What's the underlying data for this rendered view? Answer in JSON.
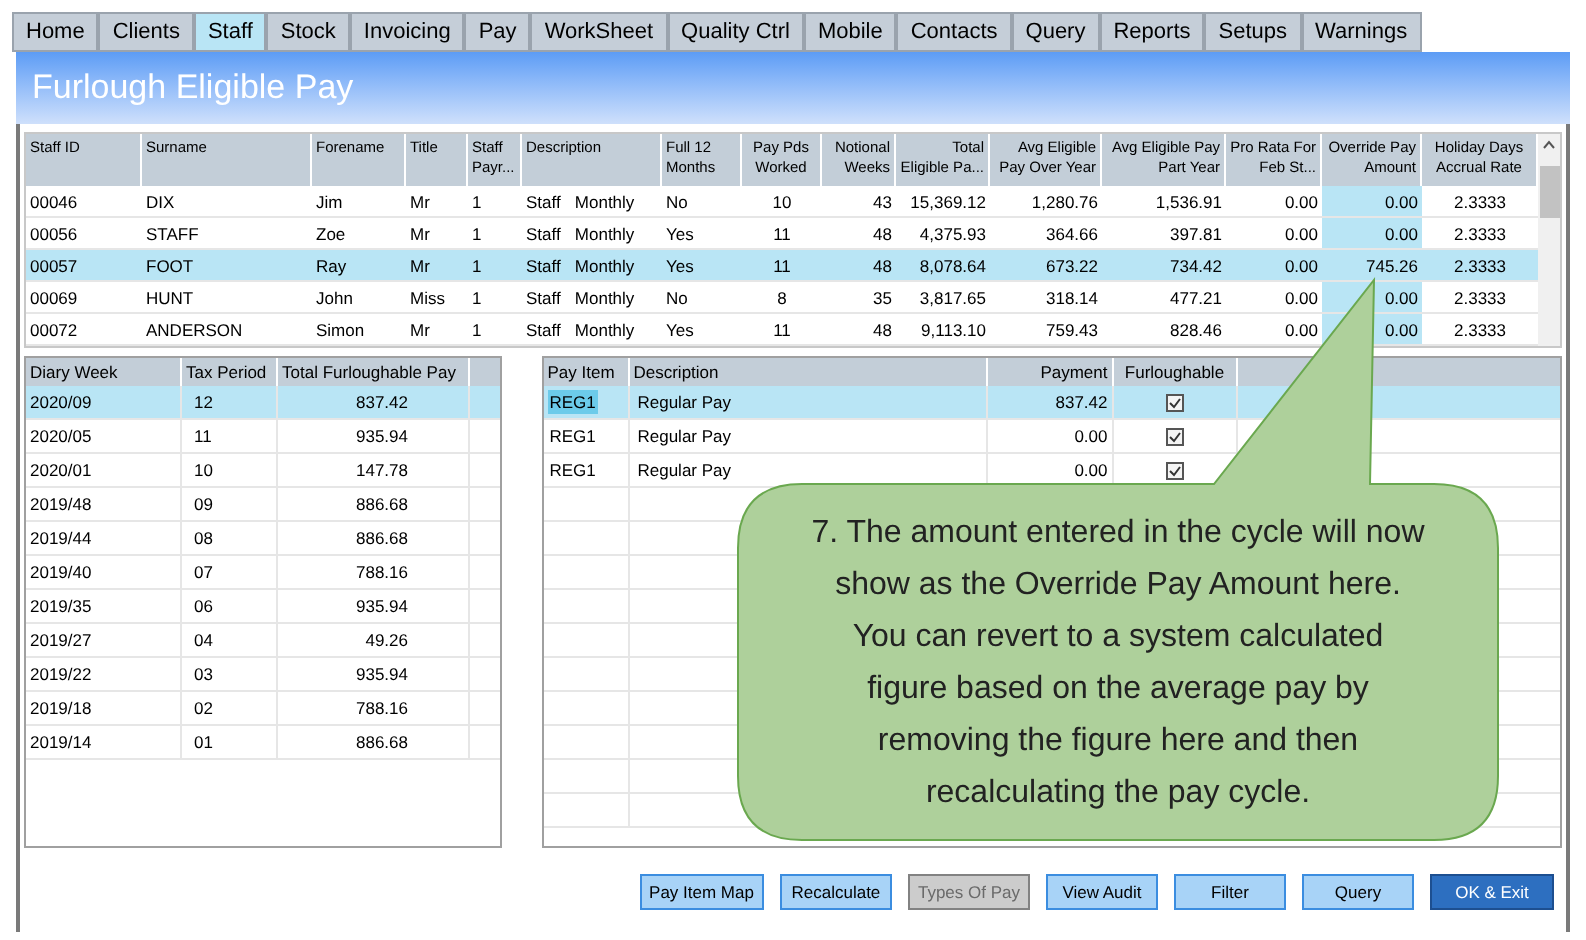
{
  "tabs": [
    {
      "label": "Home",
      "selected": false
    },
    {
      "label": "Clients",
      "selected": false
    },
    {
      "label": "Staff",
      "selected": true
    },
    {
      "label": "Stock",
      "selected": false
    },
    {
      "label": "Invoicing",
      "selected": false
    },
    {
      "label": "Pay",
      "selected": false
    },
    {
      "label": "WorkSheet",
      "selected": false
    },
    {
      "label": "Quality Ctrl",
      "selected": false
    },
    {
      "label": "Mobile",
      "selected": false
    },
    {
      "label": "Contacts",
      "selected": false
    },
    {
      "label": "Query",
      "selected": false
    },
    {
      "label": "Reports",
      "selected": false
    },
    {
      "label": "Setups",
      "selected": false
    },
    {
      "label": "Warnings",
      "selected": false
    }
  ],
  "header": {
    "title": "Furlough Eligible Pay"
  },
  "staff_table": {
    "columns": [
      "Staff ID",
      "Surname",
      "Forename",
      "Title",
      "Staff Payr...",
      "Description",
      "Full 12 Months",
      "Pay Pds Worked",
      "Notional Weeks",
      "Total Eligible Pa...",
      "Avg Eligible Pay Over Year",
      "Avg Eligible Pay Part Year",
      "Pro Rata For Feb St...",
      "Override Pay Amount",
      "Holiday Days Accrual Rate"
    ],
    "rows": [
      {
        "selected": false,
        "cells": [
          "00046",
          "DIX",
          "Jim",
          "Mr",
          "1",
          "Staff   Monthly",
          "No",
          "10",
          "43",
          "15,369.12",
          "1,280.76",
          "1,536.91",
          "0.00",
          "0.00",
          "2.3333"
        ]
      },
      {
        "selected": false,
        "cells": [
          "00056",
          "STAFF",
          "Zoe",
          "Mr",
          "1",
          "Staff   Monthly",
          "Yes",
          "11",
          "48",
          "4,375.93",
          "364.66",
          "397.81",
          "0.00",
          "0.00",
          "2.3333"
        ]
      },
      {
        "selected": true,
        "cells": [
          "00057",
          "FOOT",
          "Ray",
          "Mr",
          "1",
          "Staff   Monthly",
          "Yes",
          "11",
          "48",
          "8,078.64",
          "673.22",
          "734.42",
          "0.00",
          "745.26",
          "2.3333"
        ]
      },
      {
        "selected": false,
        "cells": [
          "00069",
          "HUNT",
          "John",
          "Miss",
          "1",
          "Staff   Monthly",
          "No",
          "8",
          "35",
          "3,817.65",
          "318.14",
          "477.21",
          "0.00",
          "0.00",
          "2.3333"
        ]
      },
      {
        "selected": false,
        "cells": [
          "00072",
          "ANDERSON",
          "Simon",
          "Mr",
          "1",
          "Staff   Monthly",
          "Yes",
          "11",
          "48",
          "9,113.10",
          "759.43",
          "828.46",
          "0.00",
          "0.00",
          "2.3333"
        ]
      }
    ]
  },
  "diary_table": {
    "columns": [
      "Diary Week",
      "Tax Period",
      "Total Furloughable Pay"
    ],
    "rows": [
      {
        "selected": true,
        "cells": [
          "2020/09",
          "12",
          "837.42"
        ]
      },
      {
        "selected": false,
        "cells": [
          "2020/05",
          "11",
          "935.94"
        ]
      },
      {
        "selected": false,
        "cells": [
          "2020/01",
          "10",
          "147.78"
        ]
      },
      {
        "selected": false,
        "cells": [
          "2019/48",
          "09",
          "886.68"
        ]
      },
      {
        "selected": false,
        "cells": [
          "2019/44",
          "08",
          "886.68"
        ]
      },
      {
        "selected": false,
        "cells": [
          "2019/40",
          "07",
          "788.16"
        ]
      },
      {
        "selected": false,
        "cells": [
          "2019/35",
          "06",
          "935.94"
        ]
      },
      {
        "selected": false,
        "cells": [
          "2019/27",
          "04",
          "49.26"
        ]
      },
      {
        "selected": false,
        "cells": [
          "2019/22",
          "03",
          "935.94"
        ]
      },
      {
        "selected": false,
        "cells": [
          "2019/18",
          "02",
          "788.16"
        ]
      },
      {
        "selected": false,
        "cells": [
          "2019/14",
          "01",
          "886.68"
        ]
      }
    ]
  },
  "pay_items_table": {
    "columns": [
      "Pay Item",
      "Description",
      "Payment",
      "Furloughable"
    ],
    "rows": [
      {
        "selected": true,
        "pay_item": "REG1",
        "description": "Regular Pay",
        "payment": "837.42",
        "furloughable": true
      },
      {
        "selected": false,
        "pay_item": "REG1",
        "description": "Regular Pay",
        "payment": "0.00",
        "furloughable": true
      },
      {
        "selected": false,
        "pay_item": "REG1",
        "description": "Regular Pay",
        "payment": "0.00",
        "furloughable": true
      }
    ]
  },
  "callout": {
    "text": "7. The amount entered in the cycle will now show as the Override Pay Amount here. You can revert to a system calculated figure based on the average pay by removing the figure here and then recalculating the pay cycle."
  },
  "buttons": [
    {
      "label": "Pay Item Map",
      "kind": "normal",
      "disabled": false
    },
    {
      "label": "Recalculate",
      "kind": "normal",
      "disabled": false
    },
    {
      "label": "Types Of Pay",
      "kind": "normal",
      "disabled": true
    },
    {
      "label": "View Audit",
      "kind": "normal",
      "disabled": false
    },
    {
      "label": "Filter",
      "kind": "normal",
      "disabled": false
    },
    {
      "label": "Query",
      "kind": "normal",
      "disabled": false
    },
    {
      "label": "OK & Exit",
      "kind": "primary",
      "disabled": false
    }
  ]
}
